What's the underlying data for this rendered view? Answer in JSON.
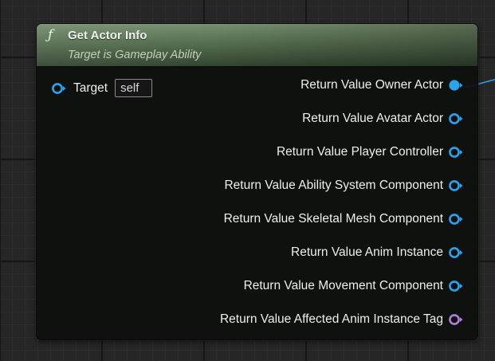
{
  "colors": {
    "object_pin": "#2aa3ee",
    "struct_pin": "#b07fdb",
    "header_top": "#76906e",
    "header_bottom": "#324530"
  },
  "node": {
    "icon": "function-icon",
    "icon_glyph": "ƒ",
    "title": "Get Actor Info",
    "subtitle": "Target is Gameplay Ability",
    "input": {
      "label": "Target",
      "value": "self"
    },
    "outputs": [
      {
        "label": "Return Value Owner Actor",
        "pin": "object",
        "connected": true
      },
      {
        "label": "Return Value Avatar Actor",
        "pin": "object",
        "connected": false
      },
      {
        "label": "Return Value Player Controller",
        "pin": "object",
        "connected": false
      },
      {
        "label": "Return Value Ability System Component",
        "pin": "object",
        "connected": false
      },
      {
        "label": "Return Value Skeletal Mesh Component",
        "pin": "object",
        "connected": false
      },
      {
        "label": "Return Value Anim Instance",
        "pin": "object",
        "connected": false
      },
      {
        "label": "Return Value Movement Component",
        "pin": "object",
        "connected": false
      },
      {
        "label": "Return Value Affected Anim Instance Tag",
        "pin": "struct",
        "connected": false
      }
    ]
  }
}
